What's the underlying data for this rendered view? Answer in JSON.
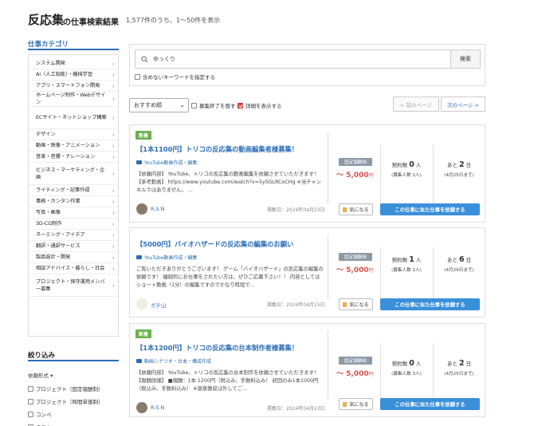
{
  "header": {
    "keyword": "反応集",
    "subtitle": "の仕事検索結果",
    "count_text": "1,577件のうち、1〜50件を表示"
  },
  "sidebar": {
    "category_heading": "仕事カテゴリ",
    "categories": [
      "システム開発",
      "AI（人工知能）・機械学習",
      "アプリ・スマートフォン開発",
      "ホームページ制作・Webデザイン",
      "ECサイト・ネットショップ構築",
      "デザイン",
      "動画・映像・アニメーション",
      "音楽・音響・ナレーション",
      "ビジネス・マーケティング・企画",
      "ライティング・記事作成",
      "事務・カンタン作業",
      "写真・画像",
      "3D-CG制作",
      "ネーミング・アイデア",
      "翻訳・通訳サービス",
      "製品設計・開発",
      "相談アドバイス・暮らし・社会",
      "プロジェクト・保守運用メンバー募集"
    ],
    "filter_heading": "絞り込み",
    "type_label": "依頼形式",
    "type_options": [
      "プロジェクト（固定報酬制）",
      "プロジェクト（時間単価制）",
      "コンペ",
      "タスク"
    ]
  },
  "search": {
    "value": "ゆっくり",
    "button": "検索",
    "exclude_label": "含めないキーワードを指定する"
  },
  "toolbar": {
    "sort_selected": "おすすめ順",
    "hide_closed_label": "募集終了を隠す",
    "show_details_label": "詳細を表示する",
    "prev_label": "< 前のページ",
    "next_label": "次のページ >"
  },
  "jobs": [
    {
      "is_new": true,
      "new_label": "新着",
      "title": "【1本1100円】トリコの反応集の動画編集者様募集！",
      "category": "YouTube動画作成・編集",
      "desc": "【依頼内容】 YouTube、トリコの反応集の動画編集を依頼させていただきます！ 【参考動画】 https://www.youtube.com/watch?v=5y5GLRCoCHg ※当チャンネルではありません。 ...",
      "user": "R.S.N",
      "posted": "掲載日：2024年04月23日",
      "badge": "固定報酬制",
      "price": "〜 5,000",
      "price_unit": "円",
      "contract_label": "契約数",
      "contract_num": "0",
      "contract_unit": "人",
      "recruit": "(募集人数 1人)",
      "remain_label": "あと",
      "remain_num": "2",
      "remain_unit": "日",
      "deadline": "(4月25日まで)",
      "fav": "気になる",
      "request": "この仕事に似た仕事を依頼する"
    },
    {
      "is_new": false,
      "new_label": "",
      "title": "【5000円】バイオハザードの反応集の編集のお願い",
      "category": "YouTube動画作成・編集",
      "desc": "ご覧いただきありがとうございます！ ゲーム「バイオハザード」の反応集の編集の依頼です！ 継続的にお仕事をされたい方は、ぜひご応募下さい！！ 内容としては ショート動画（1分）の編集ですのでかなり時短で...",
      "user": "ガチ山",
      "posted": "掲載日：2024年04月15日",
      "badge": "固定報酬制",
      "price": "〜 5,000",
      "price_unit": "円",
      "contract_label": "契約数",
      "contract_num": "1",
      "contract_unit": "人",
      "recruit": "(募集人数 2人)",
      "remain_label": "あと",
      "remain_num": "6",
      "remain_unit": "日",
      "deadline": "(4月29日まで)",
      "fav": "気になる",
      "request": "この仕事に似た仕事を依頼する"
    },
    {
      "is_new": true,
      "new_label": "新着",
      "title": "【1本1200円】トリコの反応集の台本制作者様募集！",
      "category": "動画シナリオ・台本・構成作成",
      "desc": "【依頼内容】 YouTube、トリコの反応集の台本制作を依頼させていただきます！ 【報酬詳細】 ■報酬：1本 1200円（税込み、手数料込み） 初回のみ1本1000円（税込み、手数料込み） ※源泉徴収は外してご...",
      "user": "R.S.N",
      "posted": "掲載日：2024年04月23日",
      "badge": "固定報酬制",
      "price": "〜 5,000",
      "price_unit": "円",
      "contract_label": "契約数",
      "contract_num": "0",
      "contract_unit": "人",
      "recruit": "(募集人数 3人)",
      "remain_label": "あと",
      "remain_num": "2",
      "remain_unit": "日",
      "deadline": "(4月25日まで)",
      "fav": "気になる",
      "request": "この仕事に似た仕事を依頼する"
    }
  ],
  "colors": {
    "accent": "#2a6db5",
    "price": "#d9534f",
    "new_badge": "#6ab04c",
    "request_button": "#3a8fd9"
  }
}
